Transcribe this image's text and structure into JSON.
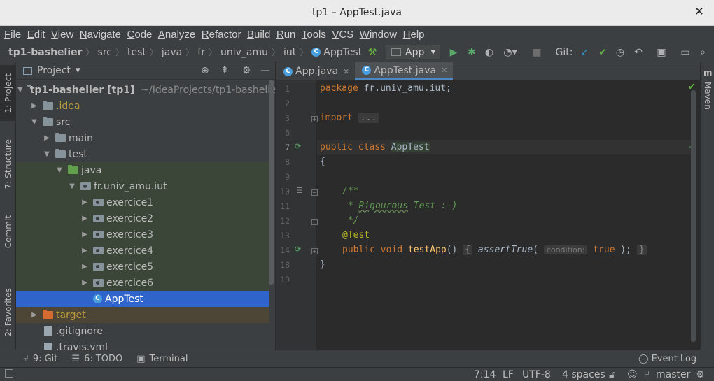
{
  "window": {
    "title": "tp1 – AppTest.java",
    "close_glyph": "✕"
  },
  "menu": [
    "File",
    "Edit",
    "View",
    "Navigate",
    "Code",
    "Analyze",
    "Refactor",
    "Build",
    "Run",
    "Tools",
    "VCS",
    "Window",
    "Help"
  ],
  "breadcrumb": [
    "tp1-bashelier",
    "src",
    "test",
    "java",
    "fr",
    "univ_amu",
    "iut",
    "AppTest"
  ],
  "toolbar": {
    "run_config": "App",
    "git_label": "Git:"
  },
  "left_tabs": {
    "project": "1: Project",
    "structure": "7: Structure",
    "commit": "Commit",
    "favorites": "2: Favorites"
  },
  "project_panel": {
    "title": "Project"
  },
  "tree": [
    {
      "label": "tp1-bashelier [tp1]",
      "suffix": "~/IdeaProjects/tp1-bashelier"
    },
    {
      "label": ".idea"
    },
    {
      "label": "src"
    },
    {
      "label": "main"
    },
    {
      "label": "test"
    },
    {
      "label": "java"
    },
    {
      "label": "fr.univ_amu.iut"
    },
    {
      "label": "exercice1"
    },
    {
      "label": "exercice2"
    },
    {
      "label": "exercice3"
    },
    {
      "label": "exercice4"
    },
    {
      "label": "exercice5"
    },
    {
      "label": "exercice6"
    },
    {
      "label": "AppTest"
    },
    {
      "label": "target"
    },
    {
      "label": ".gitignore"
    },
    {
      "label": ".travis.yml"
    }
  ],
  "editor_tabs": [
    "App.java",
    "AppTest.java"
  ],
  "line_numbers": [
    "1",
    "2",
    "3",
    "6",
    "7",
    "8",
    "9",
    "10",
    "11",
    "12",
    "13",
    "14",
    "18",
    "19"
  ],
  "code": {
    "pkg_kw": "package",
    "pkg_name": " fr.univ_amu.iut;",
    "import_kw": "import",
    "import_fold": "...",
    "public": "public",
    "class": "class",
    "class_name": "AppTest",
    "brace_open": "{",
    "cmt1": "/**",
    "cmt2_star": " * ",
    "cmt2_w1": "Rigourous",
    "cmt2_rest": " Test :-)",
    "cmt3": " */",
    "annotation": "@Test",
    "void": "void",
    "method": "testApp",
    "parens": "()",
    "body_open": "{",
    "assert": "assertTrue",
    "assert_open": "(",
    "hint": "condition:",
    "true_kw": "true",
    "assert_close": " );",
    "body_close": "}",
    "brace_close": "}"
  },
  "right_tabs": {
    "maven": "Maven"
  },
  "bottom_tools": {
    "git": "9: Git",
    "todo": "6: TODO",
    "terminal": "Terminal",
    "event_log": "Event Log"
  },
  "status": {
    "position": "7:14",
    "line_sep": "LF",
    "encoding": "UTF-8",
    "indent": "4 spaces",
    "branch": "master"
  },
  "colors": {
    "selection": "#2f65ca",
    "test_folder_bg": "#3b4638",
    "keyword": "#cc7832",
    "annotation": "#bbb529",
    "comment": "#629755",
    "method": "#ffc66d"
  }
}
